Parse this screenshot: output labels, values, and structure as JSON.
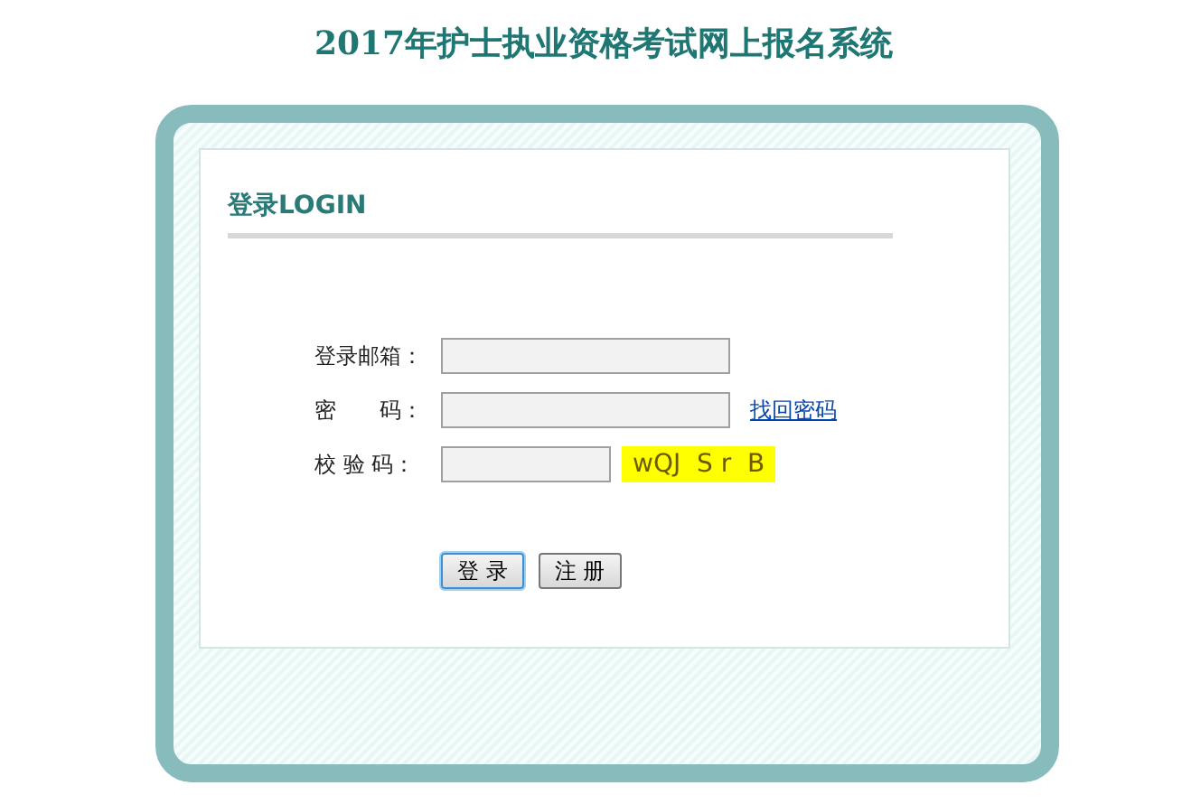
{
  "page_title": "2017年护士执业资格考试网上报名系统",
  "panel": {
    "heading": "登录LOGIN",
    "fields": [
      {
        "kind": "text",
        "label": "登录邮箱："
      },
      {
        "kind": "password",
        "label": "密　　码：",
        "link": "找回密码"
      },
      {
        "kind": "captcha",
        "label": "校 验 码：",
        "captcha": "wQJ  S r  B"
      }
    ],
    "buttons": [
      {
        "label": "登 录",
        "focused": true
      },
      {
        "label": "注 册",
        "focused": false
      }
    ]
  }
}
